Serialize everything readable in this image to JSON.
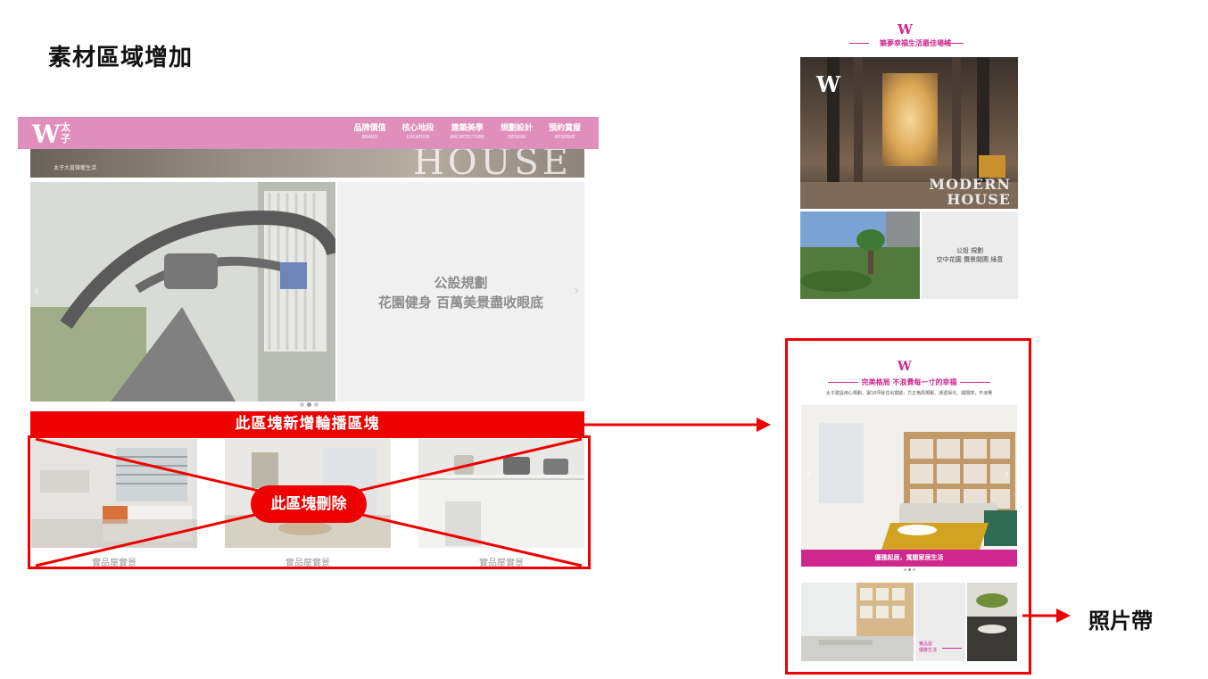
{
  "page": {
    "title": "素材區域增加"
  },
  "site": {
    "logo_w": "W",
    "logo_sub": "太\n子",
    "nav": [
      {
        "zh": "品牌價值",
        "en": "BRAND"
      },
      {
        "zh": "核心地段",
        "en": "LOCATION"
      },
      {
        "zh": "建築美學",
        "en": "ARCHITECTURE"
      },
      {
        "zh": "規劃設計",
        "en": "DESIGN"
      },
      {
        "zh": "預約賞屋",
        "en": "RESERVE"
      }
    ],
    "hero_word": "HOUSE",
    "hero_small": "太子大直微奢生活",
    "slide_line1": "公設規劃",
    "slide_line2": "花園健身 百萬美景盡收眼底",
    "chev_left": "‹",
    "chev_right": "›"
  },
  "annotations": {
    "add_carousel": "此區塊新增輪播區塊",
    "delete_block": "此區塊刪除",
    "photo_strip": "照片帶"
  },
  "thumbs": [
    {
      "caption": "實品屋實景"
    },
    {
      "caption": "實品屋實景"
    },
    {
      "caption": "實品屋實景"
    }
  ],
  "mobile1": {
    "logo": "W",
    "subtitle": "築夢幸福生活最佳場域",
    "hero_w": "W",
    "hero_modern": "MODERN",
    "hero_house": "HOUSE",
    "text_line1": "公設 規劃",
    "text_line2": "空中花園 攬景閱圃 綠意"
  },
  "mobile2": {
    "logo": "W",
    "subtitle": "完美格局 不浪費每一寸的幸福",
    "desc": "太子建設用心規劃，讓18坪就住出寬敞，方正格局規劃、通透採光、開闊感，不浪費",
    "bar_text": "優雅起居，寬闊家居生活",
    "strip_caption_1": "實品屋",
    "strip_caption_2": "優雅生活"
  },
  "colors": {
    "accent_red": "#ee0000",
    "brand_pink": "#d0278f",
    "header_pink": "#e08fbd"
  }
}
